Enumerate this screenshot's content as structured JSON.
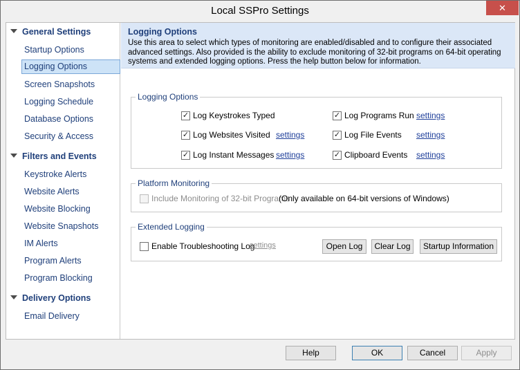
{
  "window": {
    "title": "Local SSPro Settings",
    "close_glyph": "✕"
  },
  "sidebar": {
    "groups": [
      {
        "label": "General Settings",
        "items": [
          "Startup Options",
          "Logging Options",
          "Screen Snapshots",
          "Logging Schedule",
          "Database Options",
          "Security & Access"
        ]
      },
      {
        "label": "Filters and Events",
        "items": [
          "Keystroke Alerts",
          "Website Alerts",
          "Website Blocking",
          "Website Snapshots",
          "IM Alerts",
          "Program Alerts",
          "Program Blocking"
        ]
      },
      {
        "label": "Delivery Options",
        "items": [
          "Email Delivery"
        ]
      }
    ],
    "selected": "Logging Options"
  },
  "header": {
    "title": "Logging Options",
    "description": "Use this area to select which types of monitoring are enabled/disabled and to configure their associated advanced settings. Also provided is the ability to exclude monitoring of 32-bit programs on 64-bit operating systems and extended logging options. Press the help button below for information."
  },
  "logging_options": {
    "legend": "Logging Options",
    "items": [
      {
        "label": "Log Keystrokes Typed",
        "checked": true,
        "settings": ""
      },
      {
        "label": "Log Programs Run",
        "checked": true,
        "settings": "settings"
      },
      {
        "label": "Log Websites Visited",
        "checked": true,
        "settings": "settings"
      },
      {
        "label": "Log File Events",
        "checked": true,
        "settings": "settings"
      },
      {
        "label": "Log Instant Messages",
        "checked": true,
        "settings": "settings"
      },
      {
        "label": "Clipboard Events",
        "checked": true,
        "settings": "settings"
      }
    ]
  },
  "platform_monitoring": {
    "legend": "Platform Monitoring",
    "checkbox_label": "Include Monitoring of 32-bit Programs",
    "checked": false,
    "note": "(Only available on 64-bit versions of Windows)"
  },
  "extended_logging": {
    "legend": "Extended Logging",
    "checkbox_label": "Enable Troubleshooting Log",
    "checked": false,
    "settings": "settings",
    "buttons": {
      "open_log": "Open Log",
      "clear_log": "Clear Log",
      "startup_info": "Startup Information"
    }
  },
  "footer": {
    "help": "Help",
    "ok": "OK",
    "cancel": "Cancel",
    "apply": "Apply"
  },
  "colors": {
    "accent": "#1f3f7a",
    "header_bg": "#dbe7f7",
    "selected_bg": "#cde3f7",
    "close_bg": "#c7504b"
  },
  "icons": {
    "check": "check-icon",
    "expand": "chevron-down-icon",
    "close": "close-icon"
  }
}
